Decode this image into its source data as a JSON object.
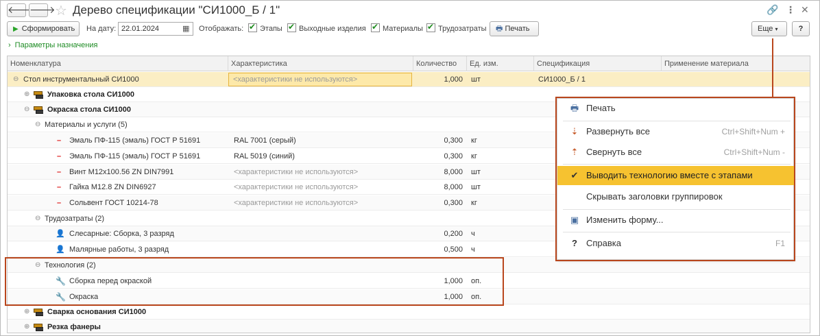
{
  "window": {
    "title": "Дерево спецификации \"СИ1000_Б / 1\"",
    "back_icon": "arrow-left-icon",
    "forward_icon": "arrow-right-icon"
  },
  "toolbar": {
    "generate_label": "Сформировать",
    "date_label": "На дату:",
    "date_value": "22.01.2024",
    "show_label": "Отображать:",
    "checkboxes": [
      {
        "label": "Этапы",
        "checked": true
      },
      {
        "label": "Выходные изделия",
        "checked": true
      },
      {
        "label": "Материалы",
        "checked": true
      },
      {
        "label": "Трудозатраты",
        "checked": true
      }
    ],
    "print_label": "Печать",
    "more_label": "Еще",
    "help_label": "?"
  },
  "params_link": "Параметры назначения",
  "table": {
    "columns": [
      "Номенклатура",
      "Характеристика",
      "Количество",
      "Ед. изм.",
      "Спецификация",
      "Применение материала"
    ],
    "rows": [
      {
        "name": "Стол инструментальный СИ1000",
        "char": "<характеристики не используются>",
        "qty": "1,000",
        "unit": "шт",
        "spec": "СИ1000_Б / 1"
      },
      {
        "name": "Упаковка стола СИ1000"
      },
      {
        "name": "Окраска стола СИ1000"
      },
      {
        "name": "Материалы и услуги (5)"
      },
      {
        "name": "Эмаль ПФ-115 (эмаль) ГОСТ Р 51691",
        "char": "RAL 7001 (серый)",
        "qty": "0,300",
        "unit": "кг"
      },
      {
        "name": "Эмаль ПФ-115 (эмаль) ГОСТ Р 51691",
        "char": "RAL 5019 (синий)",
        "qty": "0,300",
        "unit": "кг"
      },
      {
        "name": "Винт М12х100.56 ZN DIN7991",
        "char": "<характеристики не используются>",
        "qty": "8,000",
        "unit": "шт"
      },
      {
        "name": "Гайка М12.8 ZN DIN6927",
        "char": "<характеристики не используются>",
        "qty": "8,000",
        "unit": "шт"
      },
      {
        "name": "Сольвент ГОСТ 10214-78",
        "char": "<характеристики не используются>",
        "qty": "0,300",
        "unit": "кг"
      },
      {
        "name": "Трудозатраты (2)"
      },
      {
        "name": "Слесарные: Сборка, 3 разряд",
        "qty": "0,200",
        "unit": "ч"
      },
      {
        "name": "Малярные работы, 3 разряд",
        "qty": "0,500",
        "unit": "ч"
      },
      {
        "name": "Технология (2)"
      },
      {
        "name": "Сборка перед окраской",
        "qty": "1,000",
        "unit": "оп."
      },
      {
        "name": "Окраска",
        "qty": "1,000",
        "unit": "оп."
      },
      {
        "name": "Сварка основания СИ1000"
      },
      {
        "name": "Резка фанеры"
      }
    ]
  },
  "menu": {
    "items": [
      {
        "label": "Печать",
        "shortcut": "",
        "icon": "printer-icon"
      },
      {
        "label": "Развернуть все",
        "shortcut": "Ctrl+Shift+Num +",
        "icon": "expand-all-icon"
      },
      {
        "label": "Свернуть все",
        "shortcut": "Ctrl+Shift+Num -",
        "icon": "collapse-all-icon"
      },
      {
        "label": "Выводить технологию вместе с этапами",
        "shortcut": "",
        "icon": "checkmark-icon",
        "checked": true
      },
      {
        "label": "Скрывать заголовки группировок",
        "shortcut": "",
        "icon": ""
      },
      {
        "label": "Изменить форму...",
        "shortcut": "",
        "icon": "form-settings-icon"
      },
      {
        "label": "Справка",
        "shortcut": "F1",
        "icon": "help-icon"
      }
    ]
  },
  "colors": {
    "highlight": "#b9461c",
    "selected_row": "#fbeec4",
    "active_menu_item": "#f6c230",
    "link_green": "#1d8b23"
  }
}
